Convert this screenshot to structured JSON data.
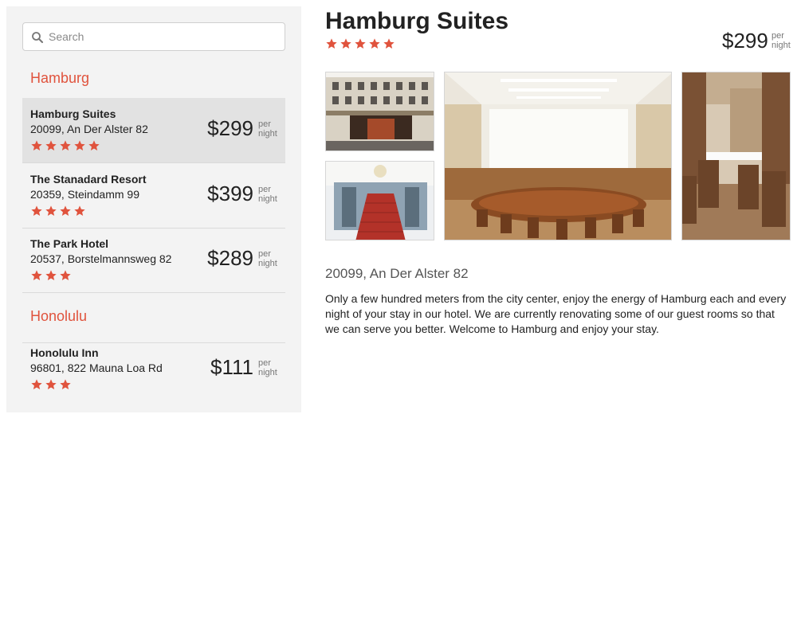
{
  "search": {
    "placeholder": "Search",
    "value": "",
    "icon": "search-icon"
  },
  "colors": {
    "accent": "#e0533d",
    "sidebar_bg": "#f3f3f3",
    "selected_bg": "#e2e2e2"
  },
  "cities": [
    {
      "name": "Hamburg",
      "hotels": [
        {
          "name": "Hamburg Suites",
          "address": "20099, An Der Alster 82",
          "price": "$299",
          "per": "per",
          "night": "night",
          "rating": 5,
          "selected": true
        },
        {
          "name": "The Stanadard Resort",
          "address": "20359, Steindamm 99",
          "price": "$399",
          "per": "per",
          "night": "night",
          "rating": 4,
          "selected": false
        },
        {
          "name": "The Park Hotel",
          "address": "20537, Borstelmannsweg 82",
          "price": "$289",
          "per": "per",
          "night": "night",
          "rating": 3,
          "selected": false
        }
      ]
    },
    {
      "name": "Honolulu",
      "hotels": [
        {
          "name": "Honolulu Inn",
          "address": "96801, 822 Mauna Loa Rd",
          "price": "$111",
          "per": "per",
          "night": "night",
          "rating": 3,
          "selected": false
        }
      ]
    }
  ],
  "detail": {
    "title": "Hamburg Suites",
    "rating": 5,
    "price": "$299",
    "per": "per",
    "night": "night",
    "address": "20099, An Der Alster 82",
    "description": "Only a few hundred meters from the city center, enjoy the energy of Hamburg each and every night of your stay in our hotel. We are currently renovating some of our guest rooms so that we can serve you better. Welcome to Hamburg and enjoy your stay.",
    "photos": [
      "hotel-facade-photo",
      "lobby-staircase-photo",
      "conference-room-photo",
      "restaurant-photo"
    ]
  }
}
